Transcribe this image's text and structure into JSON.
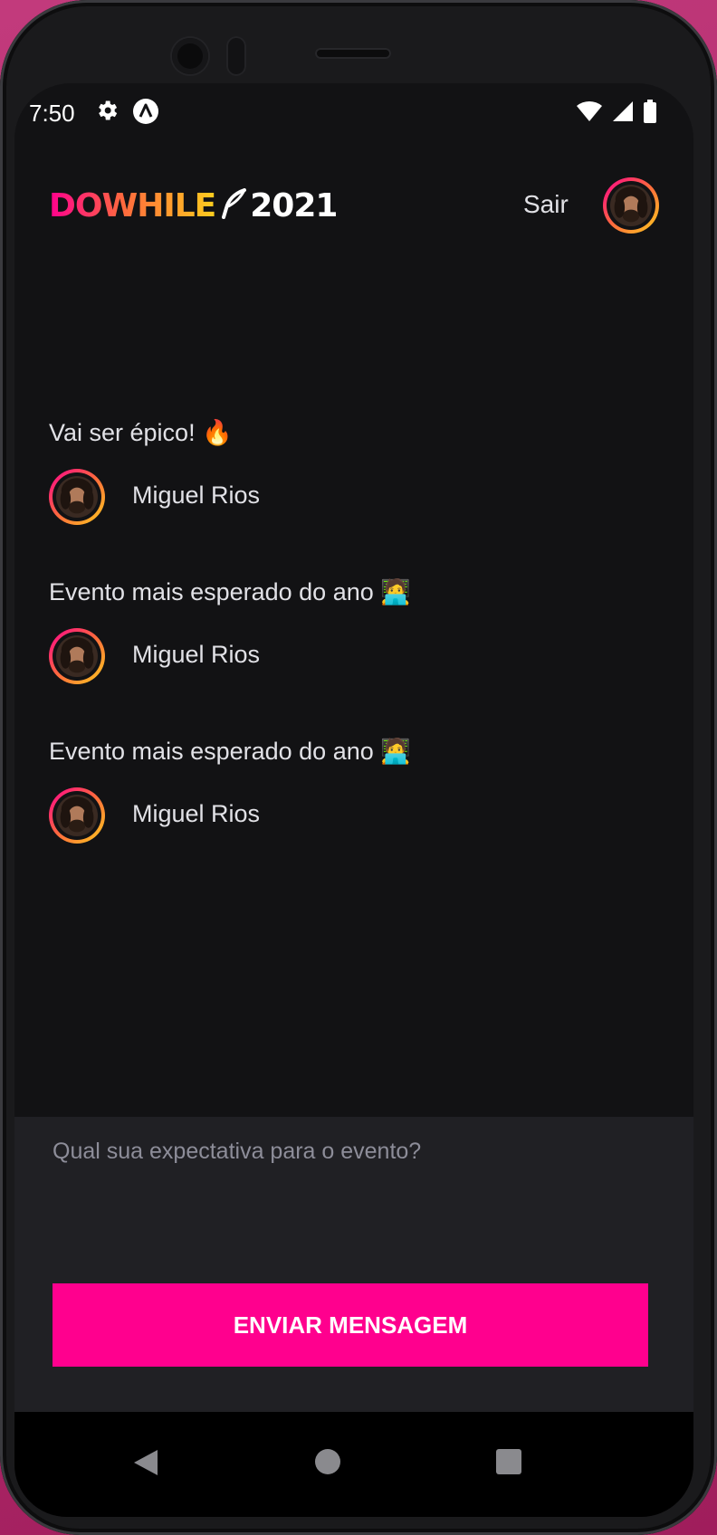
{
  "statusbar": {
    "time": "7:50",
    "icons": [
      "settings-icon",
      "app-notification-icon",
      "wifi-icon",
      "signal-icon",
      "battery-icon"
    ]
  },
  "header": {
    "logo_text": "DOWHILE",
    "logo_year": "2021",
    "signout_label": "Sair"
  },
  "messages": [
    {
      "text": "Vai ser épico! 🔥",
      "user": "Miguel Rios"
    },
    {
      "text": "Evento mais esperado do ano 🧑‍💻",
      "user": "Miguel Rios"
    },
    {
      "text": "Evento mais esperado do ano 🧑‍💻",
      "user": "Miguel Rios"
    }
  ],
  "form": {
    "placeholder": "Qual sua expectativa para o evento?",
    "value": "",
    "send_label": "ENVIAR MENSAGEM"
  },
  "colors": {
    "background": "#121214",
    "form_background": "#202024",
    "accent": "#ff008e",
    "gradient": [
      "#ff008e",
      "#ff6a3d",
      "#ffcd1e"
    ],
    "text": "#e1e1e6",
    "placeholder": "#8d8d99"
  },
  "navbar": {
    "icons": [
      "back-icon",
      "home-icon",
      "recents-icon"
    ]
  }
}
